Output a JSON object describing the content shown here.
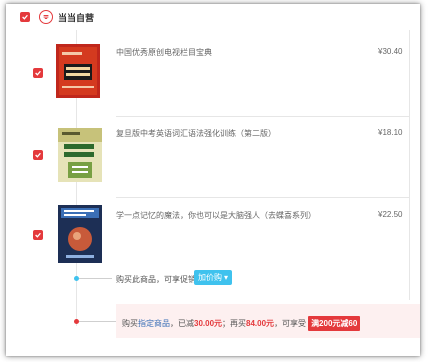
{
  "shop": {
    "name": "当当自营"
  },
  "items": [
    {
      "title": "中国优秀原创电视栏目宝典",
      "price": "¥30.40",
      "cover_text": "宝典"
    },
    {
      "title": "复旦版中考英语词汇语法强化训练（第二版）",
      "price": "¥18.10",
      "cover_text": "词汇 语法"
    },
    {
      "title": "学一点记忆的魔法，你也可以是大脑强人（去蝶喜系列）",
      "price": "¥22.50",
      "cover_text": ""
    }
  ],
  "promo": {
    "text": "购买此商品，可享促销",
    "button": "加价购",
    "arrow": "▾"
  },
  "discount": {
    "prefix": "购买",
    "link": "指定商品",
    "part1": "，已减",
    "reduced": "30.00元",
    "part2": "；再买",
    "more": "84.00元",
    "part3": "，可享受",
    "badge": "满200元减60"
  },
  "colors": {
    "accent": "#e4393c",
    "blue_button": "#3fc2ee",
    "link": "#3b6fb6",
    "promo_dot": "#3fc2ee"
  }
}
